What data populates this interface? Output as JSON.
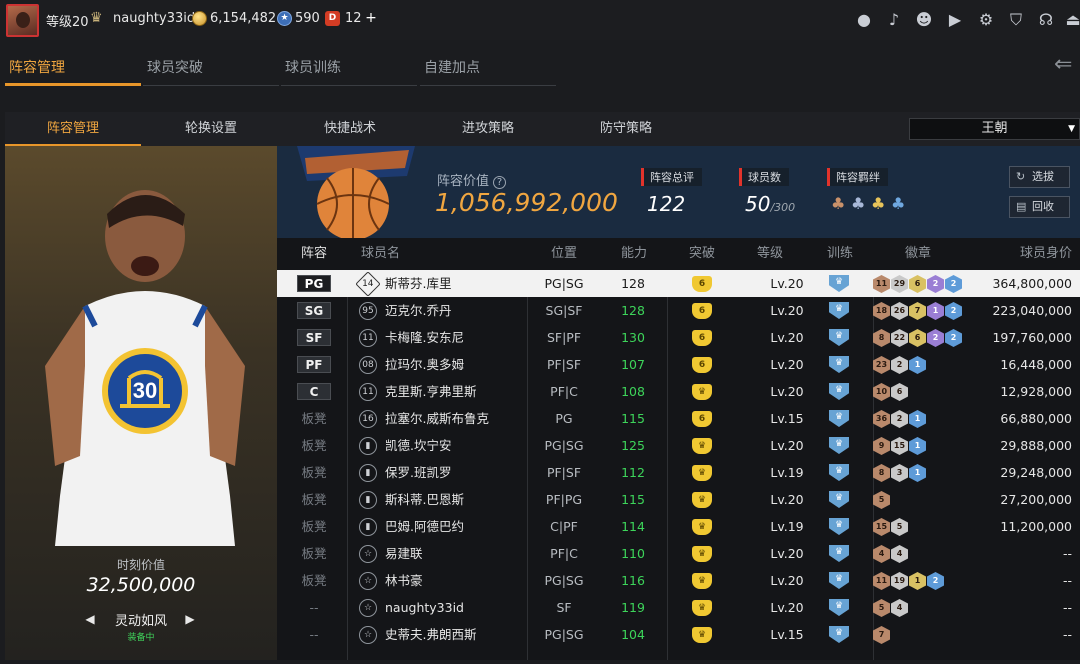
{
  "topbar": {
    "level": "等级20",
    "username": "naughty33id",
    "gold": "6,154,482",
    "stars": "590",
    "tickets": "12",
    "tickets_icon": "D",
    "plus": "+"
  },
  "main_tabs": [
    "阵容管理",
    "球员突破",
    "球员训练",
    "自建加点"
  ],
  "sub_tabs": [
    "阵容管理",
    "轮换设置",
    "快捷战术",
    "进攻策略",
    "防守策略"
  ],
  "dropdown_value": "王朝",
  "card": {
    "jersey_number": "30",
    "value_label": "时刻价值",
    "value": "32,500,000",
    "skill": "灵动如风",
    "skill_status": "装备中",
    "prev_arrow": "◀",
    "next_arrow": "▶"
  },
  "team": {
    "value_label": "阵容价值",
    "help_icon": "?",
    "value": "1,056,992,000",
    "rating_label": "阵容总评",
    "rating": "122",
    "players_label": "球员数",
    "players": "50",
    "players_max": "/300",
    "bond_label": "阵容羁绊",
    "select_btn": "选拔",
    "recycle_btn": "回收"
  },
  "table_headers": [
    "阵容",
    "球员名",
    "位置",
    "能力",
    "突破",
    "等级",
    "训练",
    "徽章",
    "球员身价"
  ],
  "rows": [
    {
      "slot": "PG",
      "starter": true,
      "num": "14",
      "name": "斯蒂芬.库里",
      "position": "PG|SG",
      "ability": "128",
      "break": "6",
      "level": "Lv.20",
      "medals": [
        [
          "bronze",
          "11"
        ],
        [
          "silver",
          "29"
        ],
        [
          "gold",
          "6"
        ],
        [
          "purple",
          "2"
        ],
        [
          "blue",
          "2"
        ]
      ],
      "value": "364,800,000"
    },
    {
      "slot": "SG",
      "starter": true,
      "num": "95",
      "name": "迈克尔.乔丹",
      "position": "SG|SF",
      "ability": "128",
      "break": "6",
      "level": "Lv.20",
      "medals": [
        [
          "bronze",
          "18"
        ],
        [
          "silver",
          "26"
        ],
        [
          "gold",
          "7"
        ],
        [
          "purple",
          "1"
        ],
        [
          "blue",
          "2"
        ]
      ],
      "value": "223,040,000"
    },
    {
      "slot": "SF",
      "starter": true,
      "num": "11",
      "name": "卡梅隆.安东尼",
      "position": "SF|PF",
      "ability": "130",
      "break": "6",
      "level": "Lv.20",
      "medals": [
        [
          "bronze",
          "8"
        ],
        [
          "silver",
          "22"
        ],
        [
          "gold",
          "6"
        ],
        [
          "purple",
          "2"
        ],
        [
          "blue",
          "2"
        ]
      ],
      "value": "197,760,000"
    },
    {
      "slot": "PF",
      "starter": true,
      "num": "08",
      "name": "拉玛尔.奥多姆",
      "position": "PF|SF",
      "ability": "107",
      "break": "6",
      "level": "Lv.20",
      "medals": [
        [
          "bronze",
          "23"
        ],
        [
          "silver",
          "2"
        ],
        [
          "blue",
          "1"
        ]
      ],
      "value": "16,448,000"
    },
    {
      "slot": "C",
      "starter": true,
      "num": "11",
      "name": "克里斯.亨弗里斯",
      "position": "PF|C",
      "ability": "108",
      "break": "",
      "level": "Lv.20",
      "medals": [
        [
          "bronze",
          "10"
        ],
        [
          "silver",
          "6"
        ]
      ],
      "value": "12,928,000"
    },
    {
      "slot": "板凳",
      "starter": false,
      "num": "16",
      "name": "拉塞尔.威斯布鲁克",
      "position": "PG",
      "ability": "115",
      "break": "6",
      "level": "Lv.15",
      "medals": [
        [
          "bronze",
          "36"
        ],
        [
          "silver",
          "2"
        ],
        [
          "blue",
          "1"
        ]
      ],
      "value": "66,880,000"
    },
    {
      "slot": "板凳",
      "starter": false,
      "num": "",
      "name": "凯德.坎宁安",
      "position": "PG|SG",
      "ability": "125",
      "break": "",
      "level": "Lv.20",
      "medals": [
        [
          "bronze",
          "9"
        ],
        [
          "silver",
          "15"
        ],
        [
          "blue",
          "1"
        ]
      ],
      "value": "29,888,000"
    },
    {
      "slot": "板凳",
      "starter": false,
      "num": "",
      "name": "保罗.班凯罗",
      "position": "PF|SF",
      "ability": "112",
      "break": "",
      "level": "Lv.19",
      "medals": [
        [
          "bronze",
          "8"
        ],
        [
          "silver",
          "3"
        ],
        [
          "blue",
          "1"
        ]
      ],
      "value": "29,248,000"
    },
    {
      "slot": "板凳",
      "starter": false,
      "num": "",
      "name": "斯科蒂.巴恩斯",
      "position": "PF|PG",
      "ability": "115",
      "break": "",
      "level": "Lv.20",
      "medals": [
        [
          "bronze",
          "5"
        ]
      ],
      "value": "27,200,000"
    },
    {
      "slot": "板凳",
      "starter": false,
      "num": "",
      "name": "巴姆.阿德巴约",
      "position": "C|PF",
      "ability": "114",
      "break": "",
      "level": "Lv.19",
      "medals": [
        [
          "bronze",
          "15"
        ],
        [
          "silver",
          "5"
        ]
      ],
      "value": "11,200,000"
    },
    {
      "slot": "板凳",
      "starter": false,
      "num": "",
      "name": "易建联",
      "position": "PF|C",
      "ability": "110",
      "break": "",
      "level": "Lv.20",
      "medals": [
        [
          "bronze",
          "4"
        ],
        [
          "silver",
          "4"
        ]
      ],
      "value": "--"
    },
    {
      "slot": "板凳",
      "starter": false,
      "num": "",
      "name": "林书豪",
      "position": "PG|SG",
      "ability": "116",
      "break": "",
      "level": "Lv.20",
      "medals": [
        [
          "bronze",
          "11"
        ],
        [
          "silver",
          "19"
        ],
        [
          "gold",
          "1"
        ],
        [
          "blue",
          "2"
        ]
      ],
      "value": "--"
    },
    {
      "slot": "--",
      "starter": false,
      "num": "",
      "name": "naughty33id",
      "position": "SF",
      "ability": "119",
      "break": "",
      "level": "Lv.20",
      "medals": [
        [
          "bronze",
          "5"
        ],
        [
          "silver",
          "4"
        ]
      ],
      "value": "--"
    },
    {
      "slot": "--",
      "starter": false,
      "num": "",
      "name": "史蒂夫.弗朗西斯",
      "position": "PG|SG",
      "ability": "104",
      "break": "",
      "level": "Lv.15",
      "medals": [
        [
          "bronze",
          "7"
        ]
      ],
      "value": "--"
    }
  ],
  "colors": {
    "accent": "#e8962a",
    "green": "#3dd45a",
    "red": "#e2332b"
  }
}
